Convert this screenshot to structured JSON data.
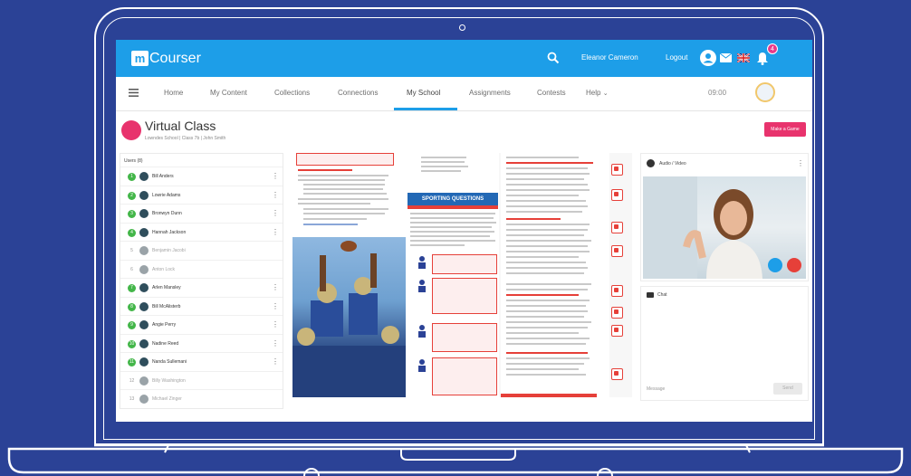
{
  "app": {
    "logo_mark": "m",
    "logo_text": "Courser"
  },
  "topbar": {
    "user_name": "Eleanor Cameron",
    "logout_label": "Logout",
    "notification_count": "4",
    "icons": [
      "search-icon",
      "user-icon",
      "mail-icon",
      "uk-flag-icon",
      "bell-icon"
    ]
  },
  "nav": {
    "items": [
      "Home",
      "My Content",
      "Collections",
      "Connections",
      "My School",
      "Assignments",
      "Contests",
      "Help"
    ],
    "active": "My School",
    "time": "09:00"
  },
  "page": {
    "title": "Virtual Class",
    "subtitle": "Lowndes School | Class 7b | John Smith",
    "action_button": "Make a Game"
  },
  "users": {
    "header": "Users (8)",
    "list": [
      {
        "num": "1",
        "name": "Bill Anders",
        "online": true
      },
      {
        "num": "2",
        "name": "Lowrie Adams",
        "online": true
      },
      {
        "num": "3",
        "name": "Bronwyn Dunn",
        "online": true
      },
      {
        "num": "4",
        "name": "Hannah Jackson",
        "online": true
      },
      {
        "num": "5",
        "name": "Benjamin Jacobi",
        "online": false
      },
      {
        "num": "6",
        "name": "Anton Lock",
        "online": false
      },
      {
        "num": "7",
        "name": "Arlen Mansley",
        "online": true
      },
      {
        "num": "8",
        "name": "Bill McAlisterb",
        "online": true
      },
      {
        "num": "9",
        "name": "Angie Perry",
        "online": true
      },
      {
        "num": "10",
        "name": "Nadine Reed",
        "online": true
      },
      {
        "num": "11",
        "name": "Nanda Sullemani",
        "online": true
      },
      {
        "num": "12",
        "name": "Billy Washington",
        "online": false
      },
      {
        "num": "13",
        "name": "Michael Zinger",
        "online": false
      }
    ]
  },
  "content": {
    "heading": "SPORTING QUESTIONS"
  },
  "video": {
    "label": "Audio / Video"
  },
  "chat": {
    "label": "Chat",
    "input_placeholder": "Message",
    "send_label": "Send"
  }
}
